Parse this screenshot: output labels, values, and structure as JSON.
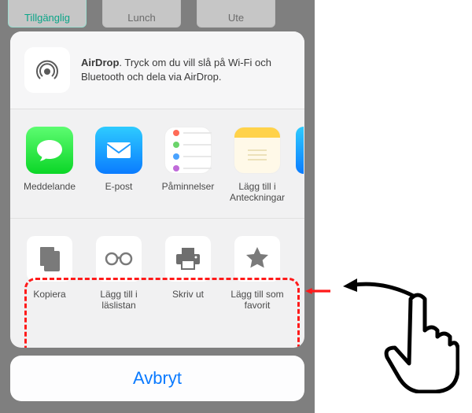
{
  "background": {
    "status1": "Tillgänglig",
    "status2": "Lunch",
    "status3": "Ute"
  },
  "airdrop": {
    "title": "AirDrop",
    "desc_suffix": ". Tryck om du vill slå på Wi-Fi och Bluetooth och dela via AirDrop."
  },
  "share_row": [
    {
      "label": "Meddelande",
      "name": "share-messages"
    },
    {
      "label": "E-post",
      "name": "share-mail"
    },
    {
      "label": "Påminnelser",
      "name": "share-reminders"
    },
    {
      "label": "Lägg till i Anteckningar",
      "name": "share-notes"
    }
  ],
  "action_row": [
    {
      "label": "Kopiera",
      "name": "action-copy"
    },
    {
      "label": "Lägg till i läslistan",
      "name": "action-readinglist"
    },
    {
      "label": "Skriv ut",
      "name": "action-print"
    },
    {
      "label": "Lägg till som favorit",
      "name": "action-favorite"
    }
  ],
  "cancel_label": "Avbryt"
}
